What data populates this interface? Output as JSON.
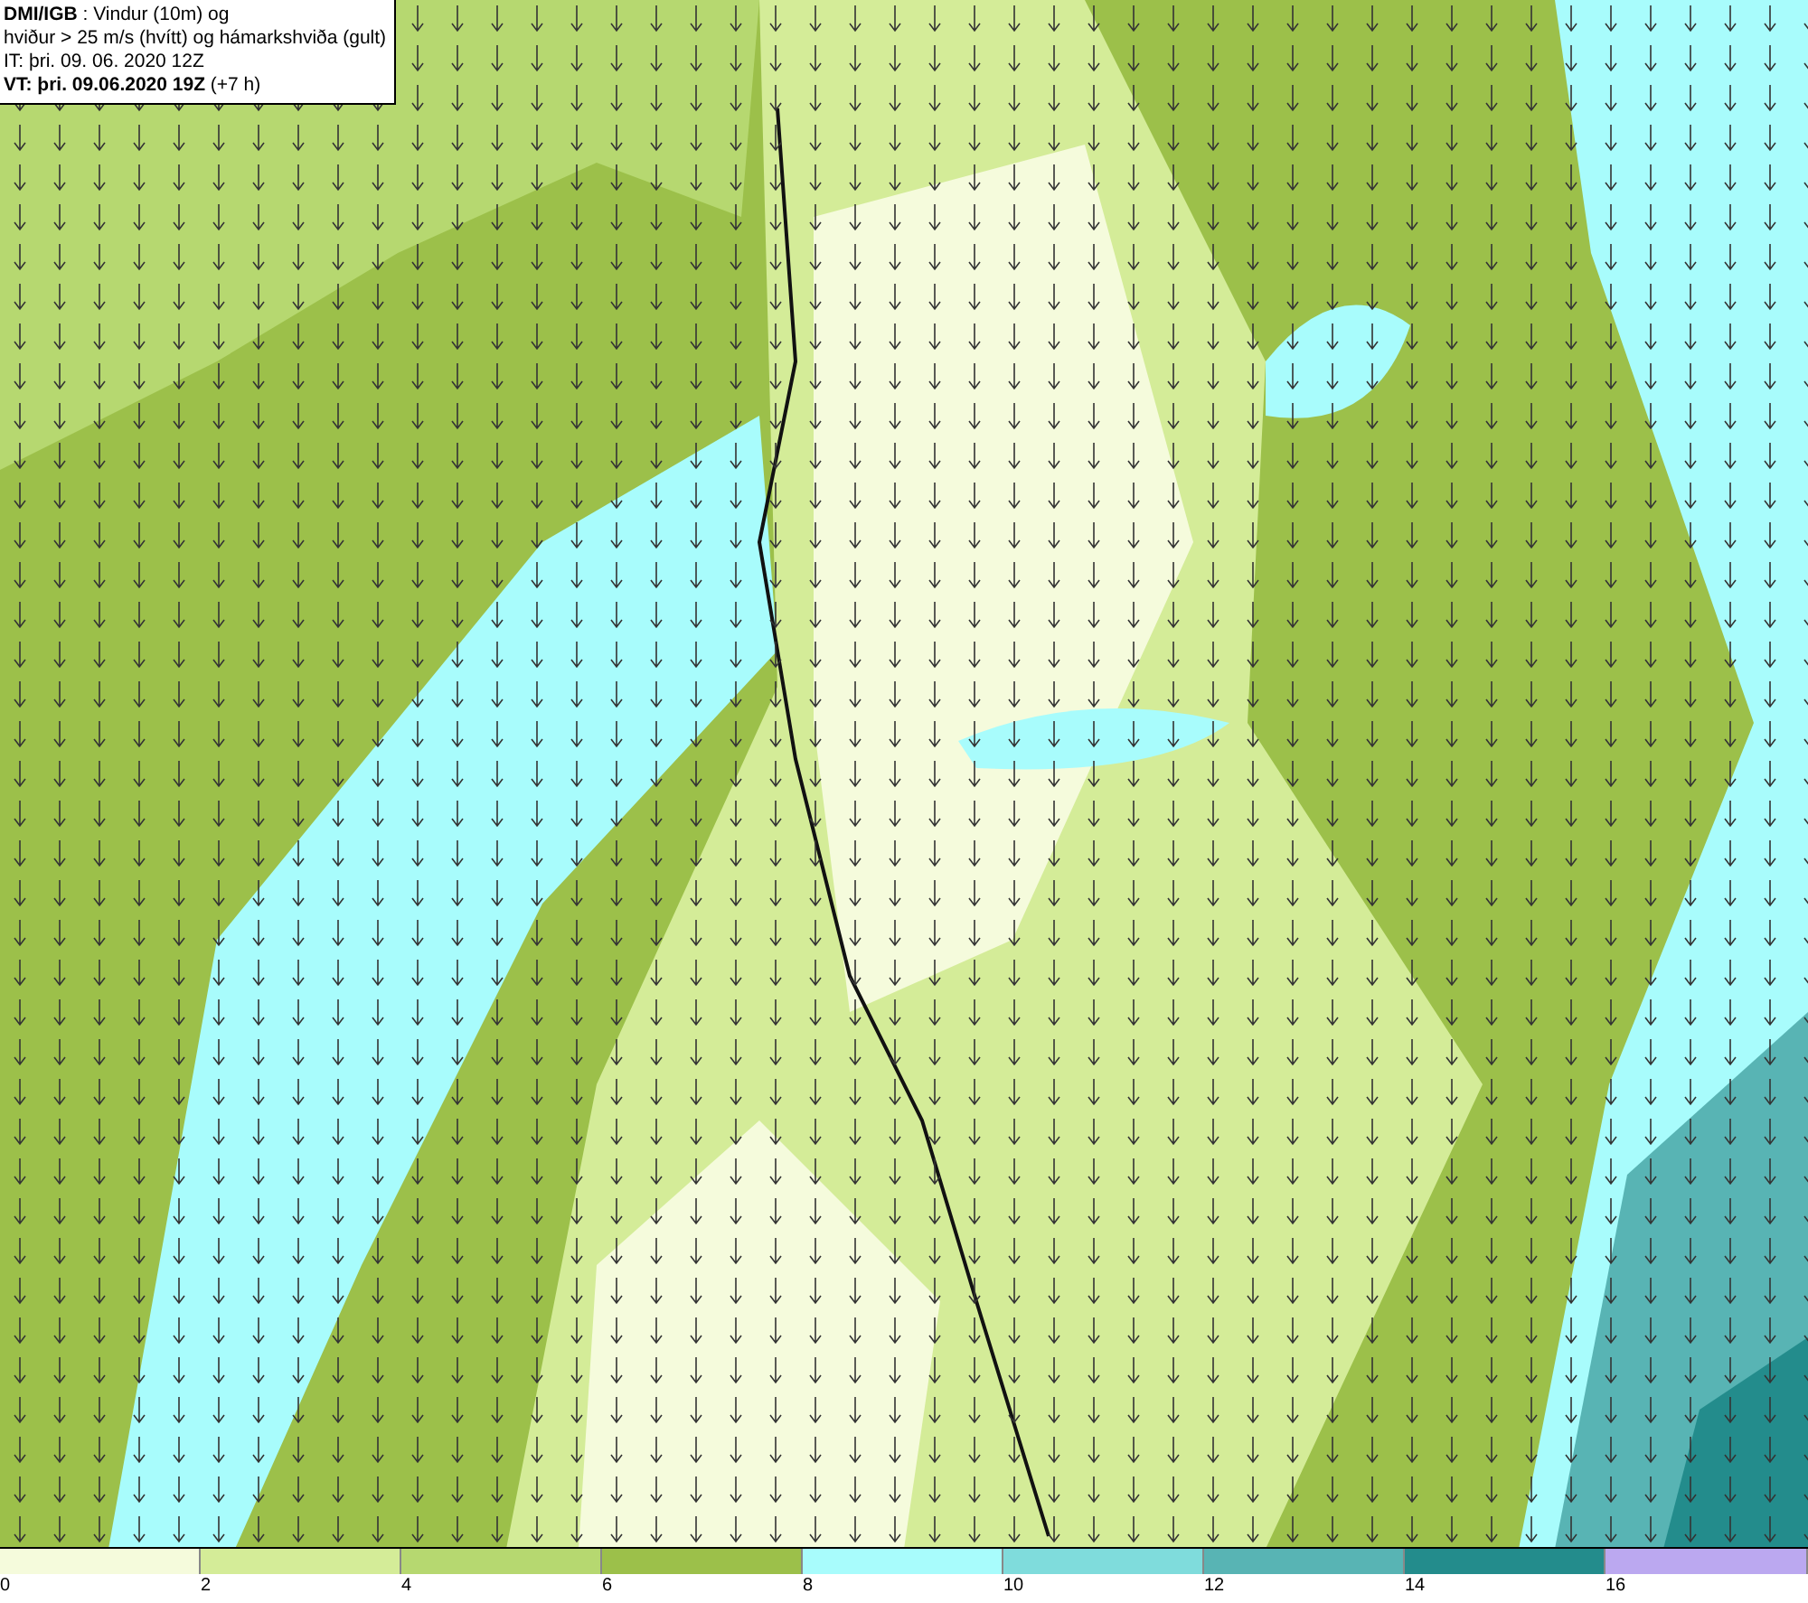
{
  "title_box": {
    "lines": [
      "**DMI/IGB** : Vindur (10m) og",
      "hviður > 25 m/s (hvítt) og hámarkshviða (gult)",
      "IT: þri. 09. 06. 2020 12Z",
      "**VT: þri. 09.06.2020 19Z** (+7 h)"
    ]
  },
  "legend": {
    "segments": [
      {
        "color": "#f5fbdc",
        "label": "0"
      },
      {
        "color": "#d4ec98",
        "label": "2"
      },
      {
        "color": "#b6d870",
        "label": "4"
      },
      {
        "color": "#9cc04a",
        "label": "6"
      },
      {
        "color": "#a8fcfc",
        "label": "8"
      },
      {
        "color": "#7fdcdc",
        "label": "10"
      },
      {
        "color": "#58b4b4",
        "label": "12"
      },
      {
        "color": "#238c8c",
        "label": "14"
      },
      {
        "color": "#bba8f0",
        "label": "16"
      }
    ]
  }
}
